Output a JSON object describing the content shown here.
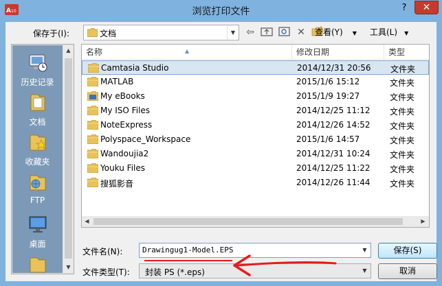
{
  "window": {
    "title": "浏览打印文件",
    "help_label": "?",
    "close_label": "✕"
  },
  "toolbar": {
    "save_in_label": "保存于(I):",
    "current_folder": "文档",
    "view_label": "查看(Y)",
    "tools_label": "工具(L)",
    "icons": [
      "back-icon",
      "up-folder-icon",
      "search-web-icon",
      "delete-icon",
      "new-folder-icon"
    ]
  },
  "places": [
    {
      "label": "历史记录",
      "icon": "history-icon"
    },
    {
      "label": "文档",
      "icon": "documents-icon"
    },
    {
      "label": "收藏夹",
      "icon": "favorites-icon"
    },
    {
      "label": "FTP",
      "icon": "ftp-icon"
    },
    {
      "label": "桌面",
      "icon": "desktop-icon"
    }
  ],
  "columns": {
    "name": "名称",
    "date": "修改日期",
    "type": "类型"
  },
  "files": [
    {
      "name": "Camtasia Studio",
      "date": "2014/12/31 20:56",
      "type": "文件夹",
      "selected": true,
      "icon": "folder-icon"
    },
    {
      "name": "MATLAB",
      "date": "2015/1/6 15:12",
      "type": "文件夹",
      "selected": false,
      "icon": "folder-icon"
    },
    {
      "name": "My eBooks",
      "date": "2015/1/9 19:27",
      "type": "文件夹",
      "selected": false,
      "icon": "ebook-folder-icon"
    },
    {
      "name": "My ISO Files",
      "date": "2014/12/25 11:12",
      "type": "文件夹",
      "selected": false,
      "icon": "folder-icon"
    },
    {
      "name": "NoteExpress",
      "date": "2014/12/26 14:52",
      "type": "文件夹",
      "selected": false,
      "icon": "folder-icon"
    },
    {
      "name": "Polyspace_Workspace",
      "date": "2015/1/6 14:57",
      "type": "文件夹",
      "selected": false,
      "icon": "folder-icon"
    },
    {
      "name": "Wandoujia2",
      "date": "2014/12/31 10:24",
      "type": "文件夹",
      "selected": false,
      "icon": "folder-icon"
    },
    {
      "name": "Youku Files",
      "date": "2014/12/25 11:22",
      "type": "文件夹",
      "selected": false,
      "icon": "folder-icon"
    },
    {
      "name": "搜狐影音",
      "date": "2014/12/26 11:44",
      "type": "文件夹",
      "selected": false,
      "icon": "folder-icon"
    }
  ],
  "form": {
    "filename_label": "文件名(N):",
    "filename_value": "Drawingug1-Model.EPS",
    "filetype_label": "文件类型(T):",
    "filetype_value": "封装 PS (*.eps)",
    "save_button": "保存(S)",
    "cancel_button": "取消"
  },
  "colors": {
    "frame": "#7fb2df",
    "selection": "#d8e6f2",
    "places_bg": "#7c9ab7",
    "annotation": "#e21d1d",
    "close_button": "#c7392f"
  }
}
